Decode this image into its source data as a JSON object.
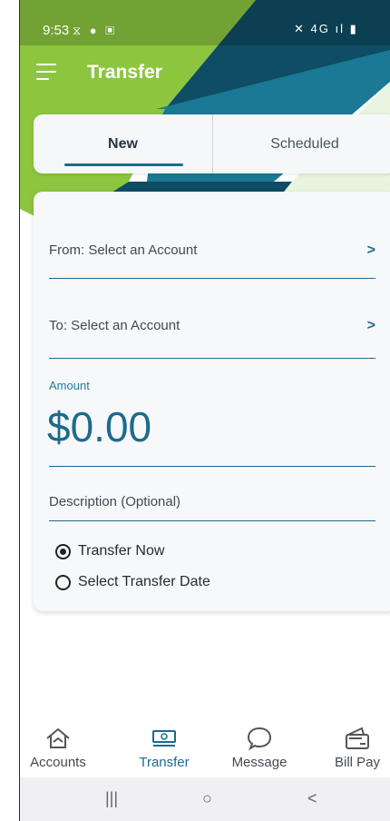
{
  "status_bar": {
    "time": "9:53",
    "left_icons": "⧖ ● ▣",
    "right_icons": "✕ 4G ıl ▮"
  },
  "header": {
    "title": "Transfer"
  },
  "tabs": [
    {
      "label": "New"
    },
    {
      "label": "Scheduled"
    }
  ],
  "form": {
    "from_label": "From: Select an Account",
    "to_label": "To: Select an Account",
    "chevron": ">",
    "amount_label": "Amount",
    "amount_value": "$0.00",
    "description_placeholder": "Description (Optional)",
    "options": [
      {
        "label": "Transfer Now",
        "selected": true
      },
      {
        "label": "Select Transfer Date",
        "selected": false
      }
    ]
  },
  "bottom_nav": [
    {
      "label": "Accounts",
      "icon": "home-icon"
    },
    {
      "label": "Transfer",
      "icon": "money-icon",
      "active": true
    },
    {
      "label": "Message",
      "icon": "chat-icon"
    },
    {
      "label": "Bill Pay",
      "icon": "wallet-icon"
    }
  ],
  "system_nav": {
    "recents": "|||",
    "home": "○",
    "back": "<"
  },
  "colors": {
    "teal": "#1c6b8c",
    "green": "#8cc63f",
    "navy": "#0e4d63"
  }
}
